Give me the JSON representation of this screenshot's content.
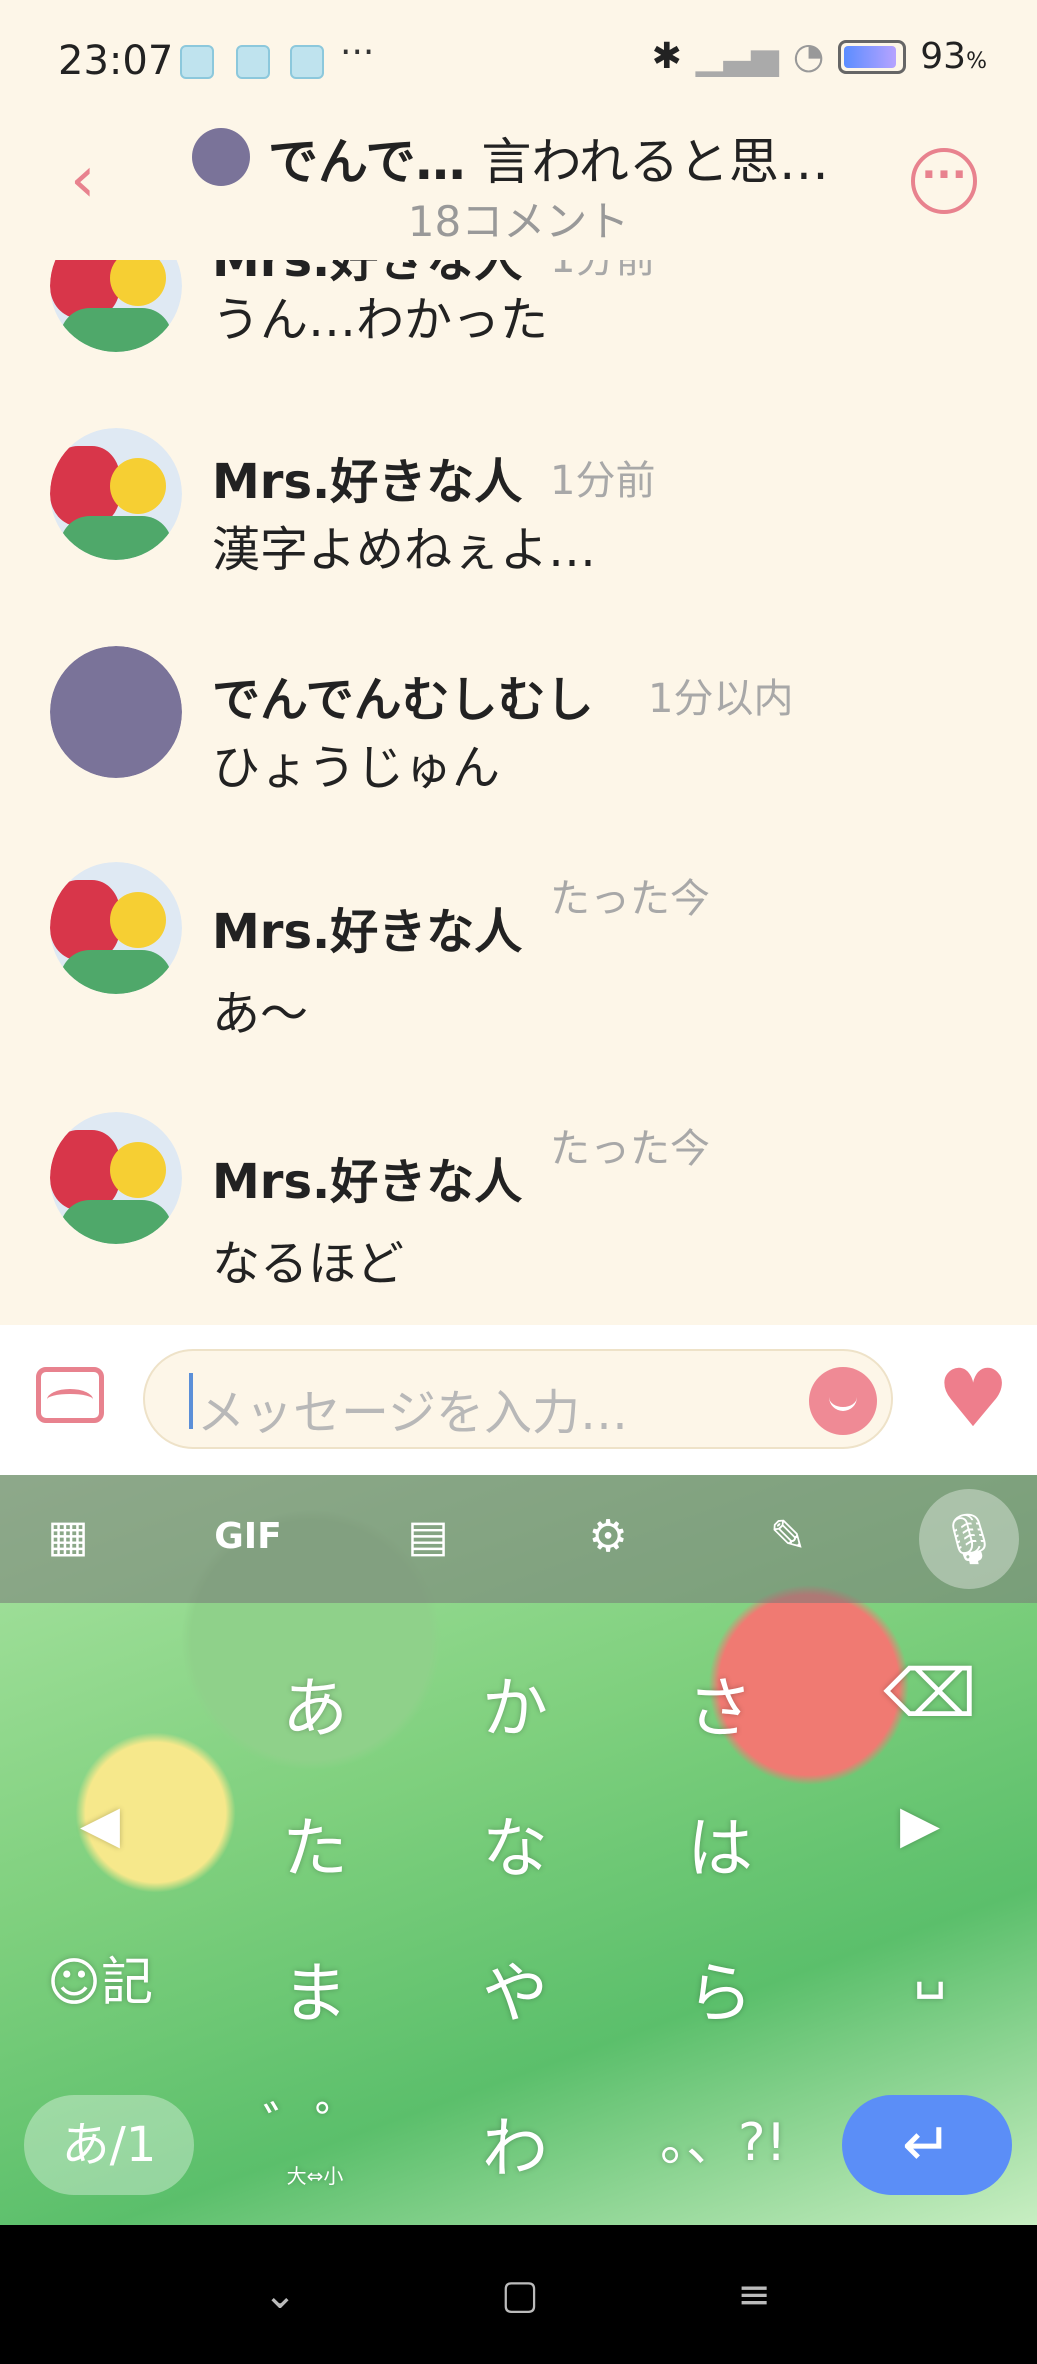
{
  "status_bar": {
    "time": "23:07",
    "more_dots": "···",
    "battery_percent": "93",
    "percent_sign": "%",
    "battery_level": 0.93
  },
  "header": {
    "title_bold": "でんで…",
    "title_rest": "言われると思…",
    "subtitle": "18コメント",
    "back_icon": "chevron-left-icon",
    "more_icon": "more-icon"
  },
  "messages": [
    {
      "name": "Mrs.好きな人",
      "time": "1分前",
      "text": "うん…わかった",
      "avatar": "illustrated"
    },
    {
      "name": "Mrs.好きな人",
      "time": "1分前",
      "text": "漢字よめねぇよ…",
      "avatar": "illustrated"
    },
    {
      "name": "でんでんむしむし",
      "time": "1分以内",
      "text": "ひょうじゅん",
      "avatar": "plain"
    },
    {
      "name": "Mrs.好きな人",
      "time": "たった今",
      "text": "あ～",
      "avatar": "illustrated"
    },
    {
      "name": "Mrs.好きな人",
      "time": "たった今",
      "text": "なるほど",
      "avatar": "illustrated"
    }
  ],
  "input": {
    "placeholder": "メッセージを入力…"
  },
  "keyboard": {
    "toolbar": [
      "GIF"
    ],
    "rows": [
      [
        "あ",
        "か",
        "さ"
      ],
      [
        "た",
        "な",
        "は"
      ],
      [
        "ま",
        "や",
        "ら"
      ]
    ],
    "emoji_key": "☺記",
    "mode_key": "あ/1",
    "dakuten_key": "゛゜",
    "dakuten_sub": "大⇔小",
    "wa_key": "わ",
    "punct_key": "。、?!",
    "colors": {
      "enter": "#5b8ef7"
    }
  },
  "colors": {
    "accent": "#e8828e",
    "background": "#fdf6e8"
  }
}
